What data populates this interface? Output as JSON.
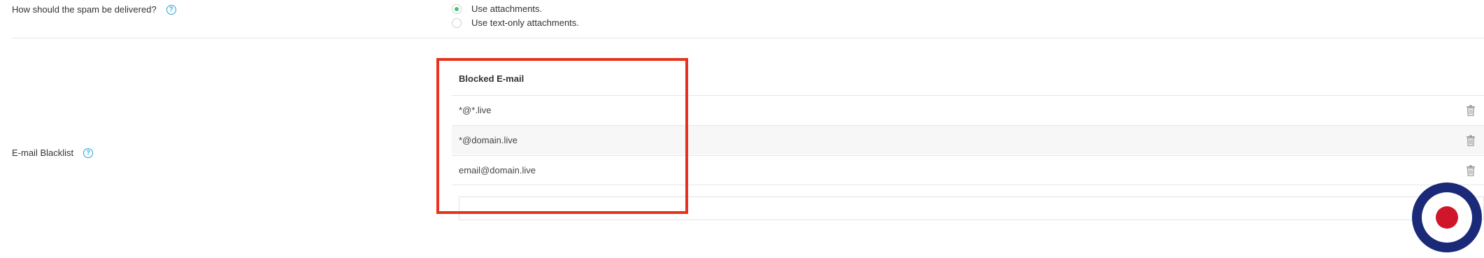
{
  "spam_delivery": {
    "label": "How should the spam be delivered?",
    "options": [
      {
        "label": "Use attachments.",
        "selected": true
      },
      {
        "label": "Use text-only attachments.",
        "selected": false
      }
    ]
  },
  "blacklist": {
    "label": "E-mail Blacklist",
    "column_header": "Blocked E-mail",
    "rows": [
      {
        "email": "*@*.live"
      },
      {
        "email": "*@domain.live"
      },
      {
        "email": "email@domain.live"
      }
    ],
    "new_entry_value": ""
  },
  "icons": {
    "help": "help-circle-icon",
    "delete": "trash-icon",
    "roundel": "roundel-icon"
  },
  "colors": {
    "accent_help": "#29a3d6",
    "radio_selected": "#3cc87a",
    "highlight": "#e8331c",
    "roundel_outer": "#1a2a78",
    "roundel_inner": "#d0162a"
  }
}
